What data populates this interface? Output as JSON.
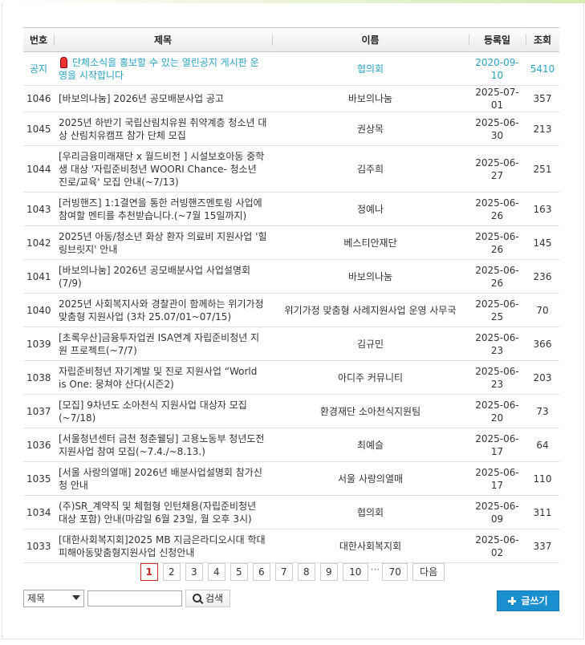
{
  "table": {
    "headers": {
      "num": "번호",
      "subject": "제목",
      "name": "이름",
      "date": "등록일",
      "views": "조회"
    },
    "notice": {
      "num": "공지",
      "subject": "단체소식을 홍보할 수 있는 열린공지 게시판 운영을 시작합니다",
      "name": "협의회",
      "date": "2020-09-10",
      "views": "5410"
    },
    "rows": [
      {
        "num": "1046",
        "subject": "[바보의나눔] 2026년 공모배분사업 공고",
        "name": "바보의나눔",
        "date": "2025-07-01",
        "views": "357"
      },
      {
        "num": "1045",
        "subject": "2025년 하반기 국립산림치유원 취약계층 청소년 대상 산림치유캠프 참가 단체 모집",
        "name": "권상목",
        "date": "2025-06-30",
        "views": "213"
      },
      {
        "num": "1044",
        "subject": "[우리금융미래재단 x 월드비전 ] 시설보호아동 중학생 대상 '자립준비청년 WOORI Chance- 청소년 진로/교육' 모집 안내(~7/13)",
        "name": "김주희",
        "date": "2025-06-27",
        "views": "251"
      },
      {
        "num": "1043",
        "subject": "[러빙핸즈] 1:1결연을 통한 러빙핸즈멘토링 사업에 참여할 멘티를 추천받습니다.(~7월 15일까지)",
        "name": "정예나",
        "date": "2025-06-26",
        "views": "163"
      },
      {
        "num": "1042",
        "subject": "2025년 아동/청소년 화상 환자 의료비 지원사업 '힐링브릿지' 안내",
        "name": "베스티안재단",
        "date": "2025-06-26",
        "views": "145"
      },
      {
        "num": "1041",
        "subject": "[바보의나눔] 2026년 공모배분사업 사업설명회(7/9)",
        "name": "바보의나눔",
        "date": "2025-06-26",
        "views": "236"
      },
      {
        "num": "1040",
        "subject": "2025년 사회복지사와 경찰관이 함께하는 위기가정 맞춤형 지원사업 (3차 25.07/01~07/15)",
        "name": "위기가정 맞춤형 사례지원사업 운영 사무국",
        "date": "2025-06-25",
        "views": "70"
      },
      {
        "num": "1039",
        "subject": "[초록우산]금융투자업권 ISA연계 자립준비청년 지원 프로젝트(~7/7)",
        "name": "김규민",
        "date": "2025-06-23",
        "views": "366"
      },
      {
        "num": "1038",
        "subject": "자립준비청년 자기계발 및 진로 지원사업 “World is One: 뭉쳐야 산다(시즌2)",
        "name": "아디주 커뮤니티",
        "date": "2025-06-23",
        "views": "203"
      },
      {
        "num": "1037",
        "subject": "[모집] 9차년도 소아천식 지원사업 대상자 모집(~7/18)",
        "name": "환경재단 소아천식지원팀",
        "date": "2025-06-20",
        "views": "73"
      },
      {
        "num": "1036",
        "subject": "[서울청년센터 금천 청춘웰딩] 고용노동부 청년도전지원사업 참여 모집(~7.4./~8.13.)",
        "name": "최예슬",
        "date": "2025-06-17",
        "views": "64"
      },
      {
        "num": "1035",
        "subject": "[서울 사랑의열매] 2026년 배분사업설명회 참가신청 안내",
        "name": "서울 사랑의열매",
        "date": "2025-06-17",
        "views": "110"
      },
      {
        "num": "1034",
        "subject": "(주)SR_계약직 및 체험형 인턴채용(자립준비청년 대상 포함) 안내(마감일 6월 23일, 월 오후 3시)",
        "name": "협의회",
        "date": "2025-06-09",
        "views": "311"
      },
      {
        "num": "1033",
        "subject": "[대한사회복지회]2025 MB 지금은라디오시대 학대피해아동맞춤형지원사업 신청안내",
        "name": "대한사회복지회",
        "date": "2025-06-02",
        "views": "337"
      }
    ]
  },
  "pagination": {
    "pages": [
      "1",
      "2",
      "3",
      "4",
      "5",
      "6",
      "7",
      "8",
      "9",
      "10"
    ],
    "ellipsis": "···",
    "last": "70",
    "next": "다음",
    "current": "1"
  },
  "search": {
    "field_selected": "제목",
    "input_value": "",
    "button_label": "검색"
  },
  "write_button": "글쓰기",
  "colors": {
    "notice": "#2aa3c4",
    "accent": "#1a8fd0",
    "active_page": "#c72828"
  }
}
